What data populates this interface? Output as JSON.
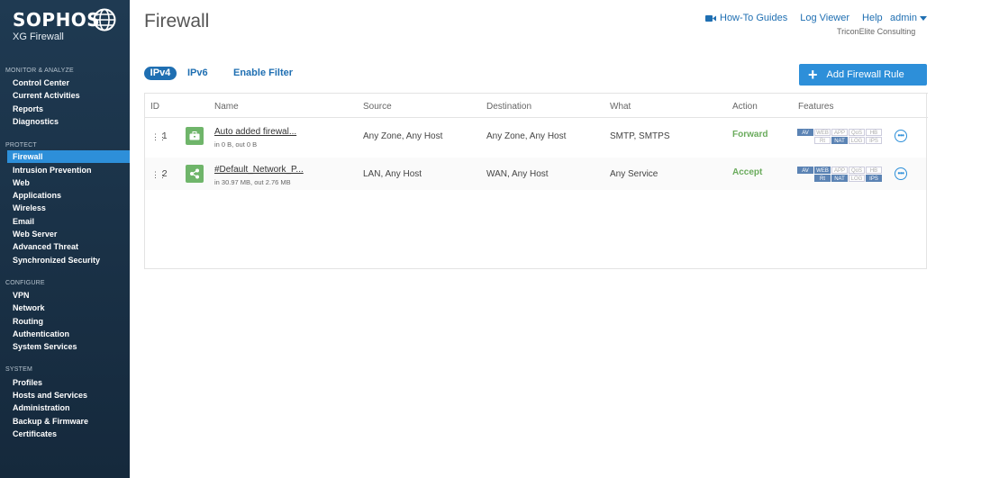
{
  "logo": {
    "brand": "SOPHOS",
    "product": "XG Firewall"
  },
  "sidebar": {
    "sections": [
      {
        "title": "MONITOR & ANALYZE",
        "items": [
          "Control Center",
          "Current Activities",
          "Reports",
          "Diagnostics"
        ]
      },
      {
        "title": "PROTECT",
        "items": [
          "Firewall",
          "Intrusion Prevention",
          "Web",
          "Applications",
          "Wireless",
          "Email",
          "Web Server",
          "Advanced Threat",
          "Synchronized Security"
        ]
      },
      {
        "title": "CONFIGURE",
        "items": [
          "VPN",
          "Network",
          "Routing",
          "Authentication",
          "System Services"
        ]
      },
      {
        "title": "SYSTEM",
        "items": [
          "Profiles",
          "Hosts and Services",
          "Administration",
          "Backup & Firmware",
          "Certificates"
        ]
      }
    ],
    "active": "Firewall"
  },
  "header": {
    "title": "Firewall",
    "links": {
      "howto": "How-To Guides",
      "logviewer": "Log Viewer",
      "help": "Help",
      "admin": "admin"
    },
    "org": "TriconElite Consulting"
  },
  "filters": {
    "ipv4": "IPv4",
    "ipv6": "IPv6",
    "enable_filter": "Enable Filter"
  },
  "add_button": "Add Firewall Rule",
  "table": {
    "headers": {
      "id": "ID",
      "name": "Name",
      "source": "Source",
      "destination": "Destination",
      "what": "What",
      "action": "Action",
      "features": "Features"
    },
    "rows": [
      {
        "id": "1",
        "name": "Auto added firewal...",
        "traffic": "in 0 B, out 0 B",
        "source": "Any Zone, Any Host",
        "destination": "Any Zone, Any Host",
        "what": "SMTP, SMTPS",
        "action": "Forward",
        "icon": "briefcase-icon",
        "features": [
          "AV",
          "WEB",
          "APP",
          "QoS",
          "HB",
          "",
          "Rt",
          "NAT",
          "LOG",
          "IPS"
        ],
        "features_on": [
          true,
          false,
          false,
          false,
          false,
          false,
          false,
          true,
          false,
          false
        ]
      },
      {
        "id": "2",
        "name": "#Default_Network_P...",
        "traffic": "in 30.97 MB, out 2.76 MB",
        "source": "LAN, Any Host",
        "destination": "WAN, Any Host",
        "what": "Any Service",
        "action": "Accept",
        "icon": "share-icon",
        "features": [
          "AV",
          "WEB",
          "APP",
          "QoS",
          "HB",
          "",
          "Rt",
          "NAT",
          "LOG",
          "IPS"
        ],
        "features_on": [
          true,
          true,
          false,
          false,
          false,
          false,
          true,
          true,
          false,
          true
        ]
      }
    ]
  }
}
